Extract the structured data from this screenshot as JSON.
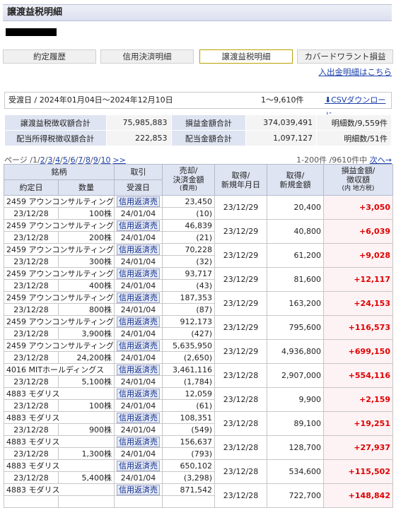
{
  "page": {
    "title": "譲渡益税明細"
  },
  "tabs": [
    {
      "label": "約定履歴",
      "active": false
    },
    {
      "label": "信用決済明細",
      "active": false
    },
    {
      "label": "譲渡益税明細",
      "active": true
    },
    {
      "label": "カバードワラント損益",
      "active": false
    }
  ],
  "withdraw_link": "入出金明細はこちら",
  "period": {
    "text": "受渡日 / 2024年01月04日～2024年12月10日",
    "count": "1～9,610件",
    "csv": "CSVダウンロード"
  },
  "summary": {
    "row1": {
      "label": "譲渡益税徴収額合計",
      "value": "75,985,883",
      "label2": "損益金額合計",
      "value2": "374,039,491",
      "count": "明細数/9,559件"
    },
    "row2": {
      "label": "配当所得税徴収額合計",
      "value": "222,853",
      "label2": "配当金額合計",
      "value2": "1,097,127",
      "count": "明細数/51件"
    }
  },
  "pager": {
    "prefix": "ページ /",
    "pages": [
      "1",
      "2",
      "3",
      "4",
      "5",
      "6",
      "7",
      "8",
      "9",
      "10"
    ],
    "next_arrows": ">>",
    "range": "1-200件 /9610件中",
    "next": "次へ→"
  },
  "headers": {
    "issue": "銘柄",
    "trade_date": "約定日",
    "quantity": "数量",
    "transaction": "取引",
    "delivery_date": "受渡日",
    "sale_line1": "売却/",
    "sale_line2": "決済金額",
    "sale_line3": "(費用)",
    "acq_date_line1": "取得/",
    "acq_date_line2": "新規年月日",
    "acq_amt_line1": "取得/",
    "acq_amt_line2": "新規金額",
    "pl_line1": "損益金額/",
    "pl_line2": "徴収額",
    "pl_line3": "(内 地方税)"
  },
  "rows": [
    {
      "issue": "2459 アウンコンサルティング",
      "trade_date": "23/12/28",
      "qty": "100株",
      "transaction": "信用返済売",
      "delivery": "24/01/04",
      "sale": "23,450",
      "fee": "(10)",
      "acq_date": "23/12/29",
      "acq_amt": "20,400",
      "pl": "+3,050"
    },
    {
      "issue": "2459 アウンコンサルティング",
      "trade_date": "23/12/28",
      "qty": "200株",
      "transaction": "信用返済売",
      "delivery": "24/01/04",
      "sale": "46,839",
      "fee": "(21)",
      "acq_date": "23/12/29",
      "acq_amt": "40,800",
      "pl": "+6,039"
    },
    {
      "issue": "2459 アウンコンサルティング",
      "trade_date": "23/12/28",
      "qty": "300株",
      "transaction": "信用返済売",
      "delivery": "24/01/04",
      "sale": "70,228",
      "fee": "(32)",
      "acq_date": "23/12/29",
      "acq_amt": "61,200",
      "pl": "+9,028"
    },
    {
      "issue": "2459 アウンコンサルティング",
      "trade_date": "23/12/28",
      "qty": "400株",
      "transaction": "信用返済売",
      "delivery": "24/01/04",
      "sale": "93,717",
      "fee": "(43)",
      "acq_date": "23/12/29",
      "acq_amt": "81,600",
      "pl": "+12,117"
    },
    {
      "issue": "2459 アウンコンサルティング",
      "trade_date": "23/12/28",
      "qty": "800株",
      "transaction": "信用返済売",
      "delivery": "24/01/04",
      "sale": "187,353",
      "fee": "(87)",
      "acq_date": "23/12/29",
      "acq_amt": "163,200",
      "pl": "+24,153"
    },
    {
      "issue": "2459 アウンコンサルティング",
      "trade_date": "23/12/28",
      "qty": "3,900株",
      "transaction": "信用返済売",
      "delivery": "24/01/04",
      "sale": "912,173",
      "fee": "(427)",
      "acq_date": "23/12/29",
      "acq_amt": "795,600",
      "pl": "+116,573"
    },
    {
      "issue": "2459 アウンコンサルティング",
      "trade_date": "23/12/28",
      "qty": "24,200株",
      "transaction": "信用返済売",
      "delivery": "24/01/04",
      "sale": "5,635,950",
      "fee": "(2,650)",
      "acq_date": "23/12/29",
      "acq_amt": "4,936,800",
      "pl": "+699,150"
    },
    {
      "issue": "4016 MITホールディングス",
      "trade_date": "23/12/28",
      "qty": "5,100株",
      "transaction": "信用返済売",
      "delivery": "24/01/04",
      "sale": "3,461,116",
      "fee": "(1,784)",
      "acq_date": "23/12/28",
      "acq_amt": "2,907,000",
      "pl": "+554,116"
    },
    {
      "issue": "4883 モダリス",
      "trade_date": "23/12/28",
      "qty": "100株",
      "transaction": "信用返済売",
      "delivery": "24/01/04",
      "sale": "12,059",
      "fee": "(61)",
      "acq_date": "23/12/28",
      "acq_amt": "9,900",
      "pl": "+2,159"
    },
    {
      "issue": "4883 モダリス",
      "trade_date": "23/12/28",
      "qty": "900株",
      "transaction": "信用返済売",
      "delivery": "24/01/04",
      "sale": "108,351",
      "fee": "(549)",
      "acq_date": "23/12/28",
      "acq_amt": "89,100",
      "pl": "+19,251"
    },
    {
      "issue": "4883 モダリス",
      "trade_date": "23/12/28",
      "qty": "1,300株",
      "transaction": "信用返済売",
      "delivery": "24/01/04",
      "sale": "156,637",
      "fee": "(793)",
      "acq_date": "23/12/28",
      "acq_amt": "128,700",
      "pl": "+27,937"
    },
    {
      "issue": "4883 モダリス",
      "trade_date": "23/12/28",
      "qty": "5,400株",
      "transaction": "信用返済売",
      "delivery": "24/01/04",
      "sale": "650,102",
      "fee": "(3,298)",
      "acq_date": "23/12/28",
      "acq_amt": "534,600",
      "pl": "+115,502"
    },
    {
      "issue": "4883 モダリス",
      "trade_date": "",
      "qty": "",
      "transaction": "信用返済売",
      "delivery": "",
      "sale": "871,542",
      "fee": "",
      "acq_date": "23/12/28",
      "acq_amt": "722,700",
      "pl": "+148,842"
    }
  ]
}
